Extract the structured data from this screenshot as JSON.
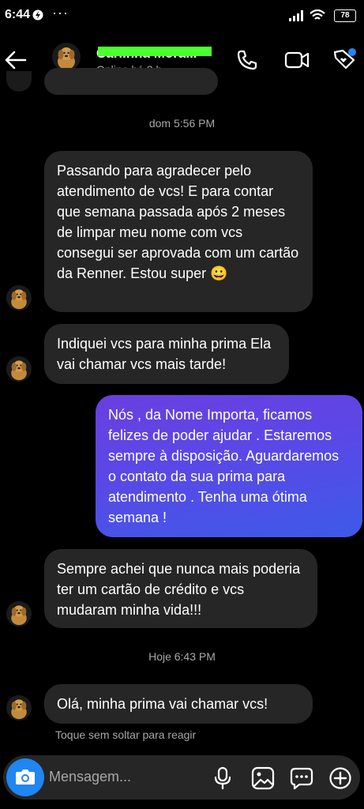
{
  "status_bar": {
    "time": "6:44",
    "battery": "78"
  },
  "header": {
    "contact_name": "Carlinha Mora...",
    "status": "Online há 3 h"
  },
  "messages": [
    {
      "type": "timestamp",
      "text": "dom 5:56 PM"
    },
    {
      "type": "incoming",
      "text": "Passando para agradecer pelo atendimento de vcs! E para contar que semana passada após 2 meses de limpar meu nome com vcs consegui ser aprovada com um cartão da Renner. Estou super 😀"
    },
    {
      "type": "incoming",
      "text": "Indiquei vcs para minha prima Ela vai chamar vcs mais tarde!"
    },
    {
      "type": "outgoing",
      "text": "Nós , da Nome Importa, ficamos felizes de poder ajudar . Estaremos sempre à disposição. Aguardaremos o contato da sua prima para atendimento . Tenha uma ótima semana !"
    },
    {
      "type": "incoming",
      "text": "Sempre achei que nunca mais poderia ter um cartão de crédito e vcs mudaram minha vida!!!"
    },
    {
      "type": "timestamp",
      "text": "Hoje 6:43 PM"
    },
    {
      "type": "incoming",
      "text": "Olá,  minha prima vai chamar vcs!"
    }
  ],
  "react_hint": "Toque sem soltar para reagir",
  "composer": {
    "placeholder": "Mensagem..."
  },
  "colors": {
    "background": "#000000",
    "incoming_bubble": "#262626",
    "outgoing_gradient_start": "#6a3fe0",
    "outgoing_gradient_end": "#3d5ae8",
    "camera_button": "#1f86f2",
    "badge": "#1f86f2"
  },
  "icons": [
    "back-arrow-icon",
    "phone-icon",
    "video-call-icon",
    "tag-icon",
    "camera-icon",
    "microphone-icon",
    "gallery-icon",
    "sticker-icon",
    "add-icon"
  ]
}
